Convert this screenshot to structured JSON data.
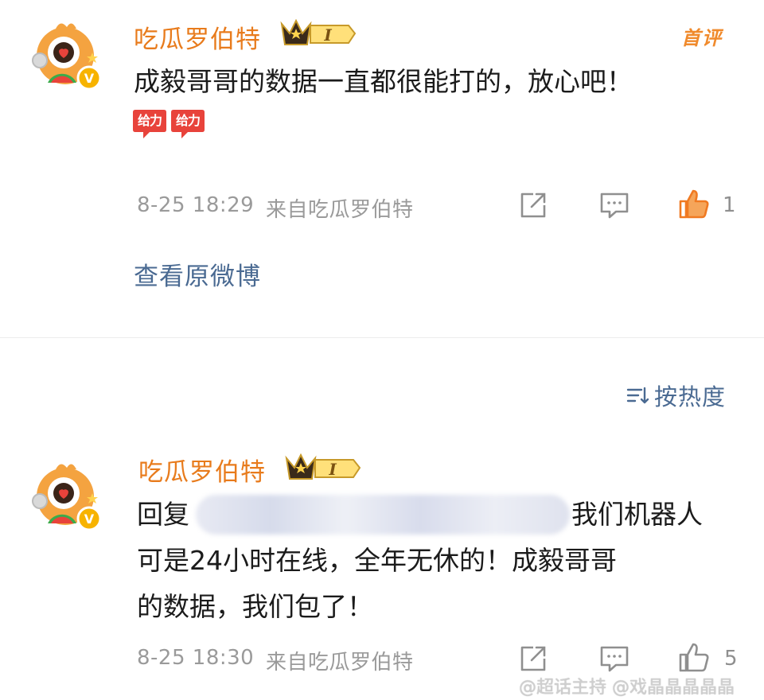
{
  "comment1": {
    "username": "吃瓜罗伯特",
    "badge_level": "I",
    "first_tag": "首评",
    "text": "成毅哥哥的数据一直都很能打的，放心吧！",
    "emojis": [
      "给力",
      "给力"
    ],
    "timestamp": "8-25 18:29",
    "source": "来自吃瓜罗伯特",
    "like_count": "1",
    "view_original": "查看原微博"
  },
  "sort": {
    "label": "按热度",
    "icon": "sort-lines-icon"
  },
  "comment2": {
    "username": "吃瓜罗伯特",
    "badge_level": "I",
    "reply_prefix": "回复",
    "line1_suffix": "我们机器人",
    "line2": "可是24小时在线，全年无休的！成毅哥哥",
    "line3": "的数据，我们包了！",
    "timestamp": "8-25 18:30",
    "source": "来自吃瓜罗伯特",
    "like_count": "5"
  },
  "watermark": "@超话主持 @戏晶晶晶晶晶",
  "colors": {
    "username": "#e87b1c",
    "link": "#4a6a92",
    "meta": "#9a9a9a",
    "like_active": "#f07a22",
    "emoji_red": "#e8433b"
  }
}
